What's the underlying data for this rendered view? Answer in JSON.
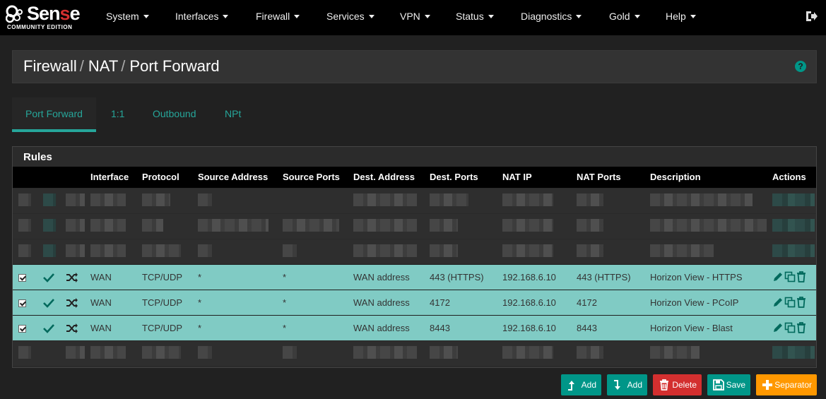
{
  "brand": {
    "name_pre": "Sen",
    "name_red": "s",
    "name_post": "e",
    "edition": "COMMUNITY EDITION"
  },
  "nav": {
    "items": [
      "System",
      "Interfaces",
      "Firewall",
      "Services",
      "VPN",
      "Status",
      "Diagnostics",
      "Gold",
      "Help"
    ]
  },
  "breadcrumb": {
    "part1": "Firewall",
    "part2": "NAT",
    "part3": "Port Forward",
    "separator": "/"
  },
  "tabs": [
    "Port Forward",
    "1:1",
    "Outbound",
    "NPt"
  ],
  "rules": {
    "title": "Rules",
    "columns": [
      "Interface",
      "Protocol",
      "Source Address",
      "Source Ports",
      "Dest. Address",
      "Dest. Ports",
      "NAT IP",
      "NAT Ports",
      "Description",
      "Actions"
    ],
    "rows": [
      {
        "interface": "WAN",
        "protocol": "TCP/UDP",
        "source_address": "*",
        "source_ports": "*",
        "dest_address": "WAN address",
        "dest_ports": "443 (HTTPS)",
        "nat_ip": "192.168.6.10",
        "nat_ports": "443 (HTTPS)",
        "description": "Horizon View - HTTPS"
      },
      {
        "interface": "WAN",
        "protocol": "TCP/UDP",
        "source_address": "*",
        "source_ports": "*",
        "dest_address": "WAN address",
        "dest_ports": "4172",
        "nat_ip": "192.168.6.10",
        "nat_ports": "4172",
        "description": "Horizon View - PCoIP"
      },
      {
        "interface": "WAN",
        "protocol": "TCP/UDP",
        "source_address": "*",
        "source_ports": "*",
        "dest_address": "WAN address",
        "dest_ports": "8443",
        "nat_ip": "192.168.6.10",
        "nat_ports": "8443",
        "description": "Horizon View - Blast"
      }
    ]
  },
  "buttons": {
    "add_top": "Add",
    "add_bottom": "Add",
    "delete": "Delete",
    "save": "Save",
    "separator": "Separator"
  },
  "colors": {
    "accent": "#009688",
    "highlight_row": "#80cbc4",
    "danger": "#d32f2f",
    "warning": "#ff9800",
    "navbar": "#000000"
  },
  "icons": [
    "check-icon",
    "shuffle-icon",
    "pencil-icon",
    "copy-icon",
    "trash-icon",
    "help-icon",
    "logout-icon"
  ]
}
